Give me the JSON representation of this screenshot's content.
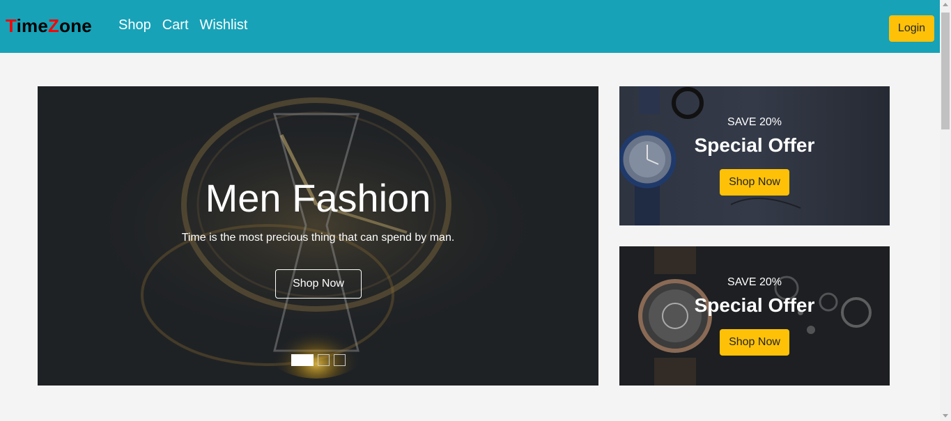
{
  "navbar": {
    "brand_first_letter_1": "T",
    "brand_rest_1": "ime",
    "brand_first_letter_2": "Z",
    "brand_rest_2": "one",
    "links": [
      "Shop",
      "Cart",
      "Wishlist"
    ],
    "login_label": "Login"
  },
  "hero": {
    "title": "Men Fashion",
    "subtitle": "Time is the most precious thing that can spend by man.",
    "button_label": "Shop Now",
    "slides_count": 3,
    "active_slide": 1
  },
  "offers": [
    {
      "save": "SAVE 20%",
      "title": "Special Offer",
      "button_label": "Shop Now"
    },
    {
      "save": "SAVE 20%",
      "title": "Special Offer",
      "button_label": "Shop Now"
    }
  ],
  "colors": {
    "navbar_bg": "#17a2b8",
    "accent": "#ffc107",
    "brand_highlight": "#ff0000",
    "page_bg": "#f4f4f4"
  }
}
